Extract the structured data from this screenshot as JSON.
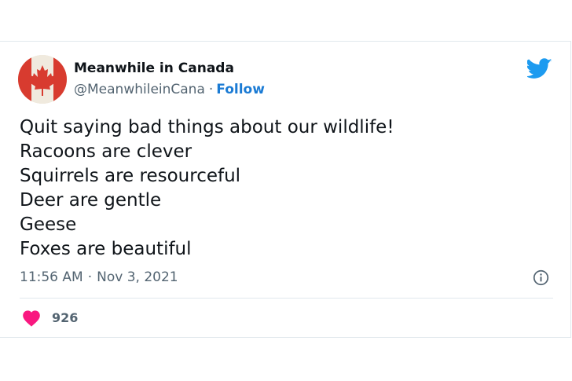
{
  "account": {
    "display_name": "Meanwhile in Canada",
    "handle": "@MeanwhileinCana",
    "separator": "·",
    "follow_label": "Follow"
  },
  "tweet": {
    "lines": [
      "Quit saying bad things about our wildlife!",
      "Racoons are clever",
      "Squirrels are resourceful",
      "Deer are gentle",
      "Geese",
      "Foxes are beautiful"
    ],
    "time": "11:56 AM",
    "date_separator": "·",
    "date": "Nov 3, 2021"
  },
  "stats": {
    "likes": "926"
  },
  "icons": {
    "brand": "twitter-bird-icon",
    "avatar": "canadian-flag",
    "info": "info-icon",
    "like": "heart-icon"
  },
  "colors": {
    "twitter_blue": "#1d9bf0",
    "follow_blue": "#1b7bd4",
    "heart_pink": "#f91880",
    "flag_red": "#d52b1e",
    "muted_text": "#536471"
  }
}
